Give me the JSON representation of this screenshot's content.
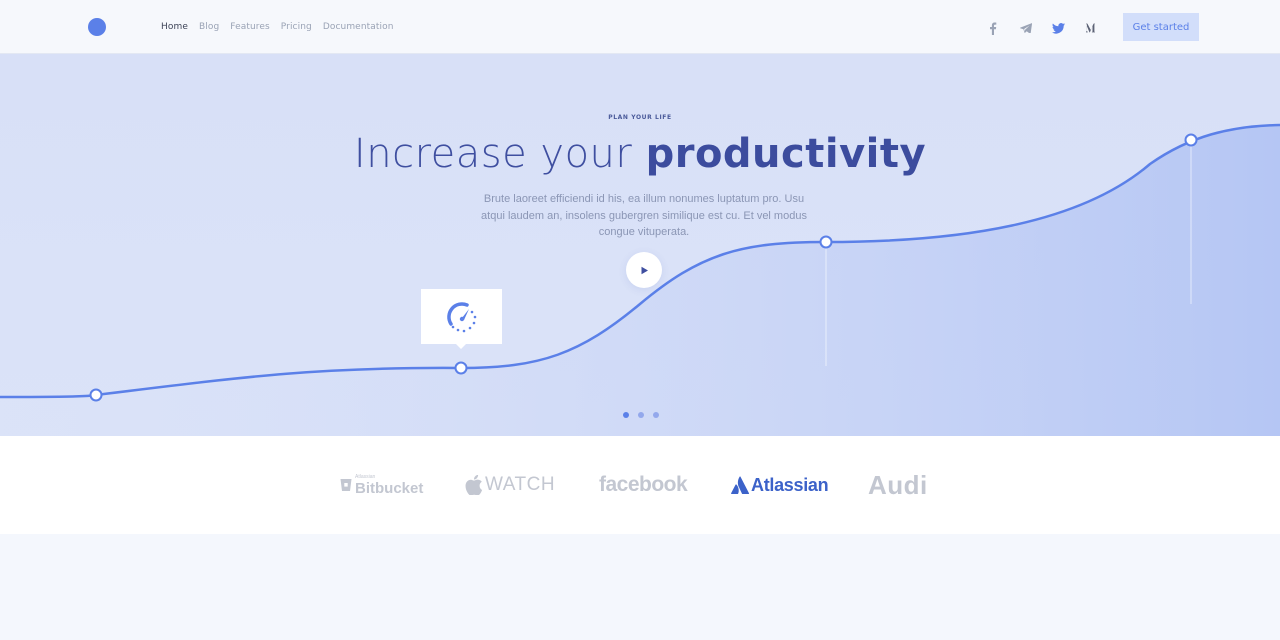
{
  "header": {
    "nav": [
      "Home",
      "Blog",
      "Features",
      "Pricing",
      "Documentation"
    ],
    "socials": [
      "facebook-icon",
      "telegram-icon",
      "twitter-icon",
      "medium-icon"
    ],
    "cta_label": "Get started"
  },
  "hero": {
    "eyebrow": "PLAN YOUR LIFE",
    "headline_light": "Increase your ",
    "headline_bold": "productivity",
    "body": "Brute laoreet efficiendi id his, ea illum nonumes luptatum pro. Usu atqui laudem an, insolens gubergren similique est cu. Et vel modus congue vituperata.",
    "slides": 3,
    "active_slide": 0
  },
  "logos": {
    "bitbucket_small": "Atlassian",
    "bitbucket": "Bitbucket",
    "watch": "WATCH",
    "facebook": "facebook",
    "atlassian": "Atlassian",
    "audi": "Audi"
  },
  "colors": {
    "accent": "#5b80e8",
    "headline": "#3f4fa0",
    "hero_bg": "#d8e0f7",
    "logo_gray": "#c3c7d1",
    "atlassian_blue": "#3c62c9"
  }
}
